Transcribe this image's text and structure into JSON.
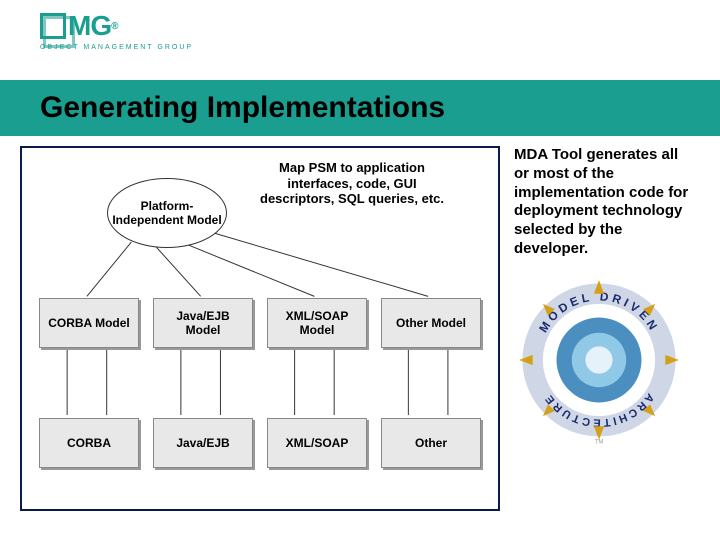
{
  "logo": {
    "text": "MG",
    "sub": "OBJECT MANAGEMENT GROUP"
  },
  "title": "Generating Implementations",
  "diagram": {
    "pim": "Platform-Independent Model",
    "map_text": "Map PSM to application interfaces, code, GUI descriptors, SQL queries, etc.",
    "models": [
      "CORBA Model",
      "Java/EJB Model",
      "XML/SOAP Model",
      "Other Model"
    ],
    "impls": [
      "CORBA",
      "Java/EJB",
      "XML/SOAP",
      "Other"
    ]
  },
  "description": "MDA Tool generates all or most of the implementation code for deployment technology selected by the developer."
}
